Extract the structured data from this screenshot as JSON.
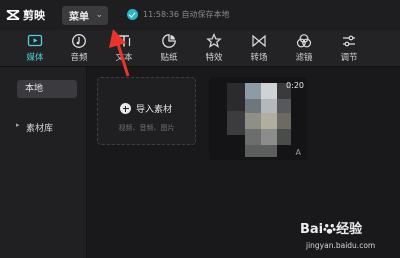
{
  "app": {
    "name": "剪映"
  },
  "titlebar": {
    "menu_label": "菜单",
    "menu_caret": "⌄",
    "save_status": "11:58:36 自动保存本地"
  },
  "toolbar": {
    "items": [
      {
        "label": "媒体",
        "icon": "media-icon",
        "active": true
      },
      {
        "label": "音频",
        "icon": "audio-icon"
      },
      {
        "label": "文本",
        "icon": "text-icon"
      },
      {
        "label": "贴纸",
        "icon": "sticker-icon"
      },
      {
        "label": "特效",
        "icon": "effects-icon"
      },
      {
        "label": "转场",
        "icon": "transition-icon"
      },
      {
        "label": "滤镜",
        "icon": "filter-icon"
      },
      {
        "label": "调节",
        "icon": "adjust-icon"
      }
    ],
    "active_color": "#4fd0dd"
  },
  "sidebar": {
    "local": "本地",
    "library": "素材库"
  },
  "import": {
    "label": "导入素材",
    "sub": "视频、音频、图片"
  },
  "media": {
    "duration": "0:20",
    "corner": "A"
  },
  "watermark": {
    "brand": "Bai",
    "brand_suffix": "经验",
    "url": "jingyan.baidu.com"
  },
  "annotation_color": "#e8342b"
}
